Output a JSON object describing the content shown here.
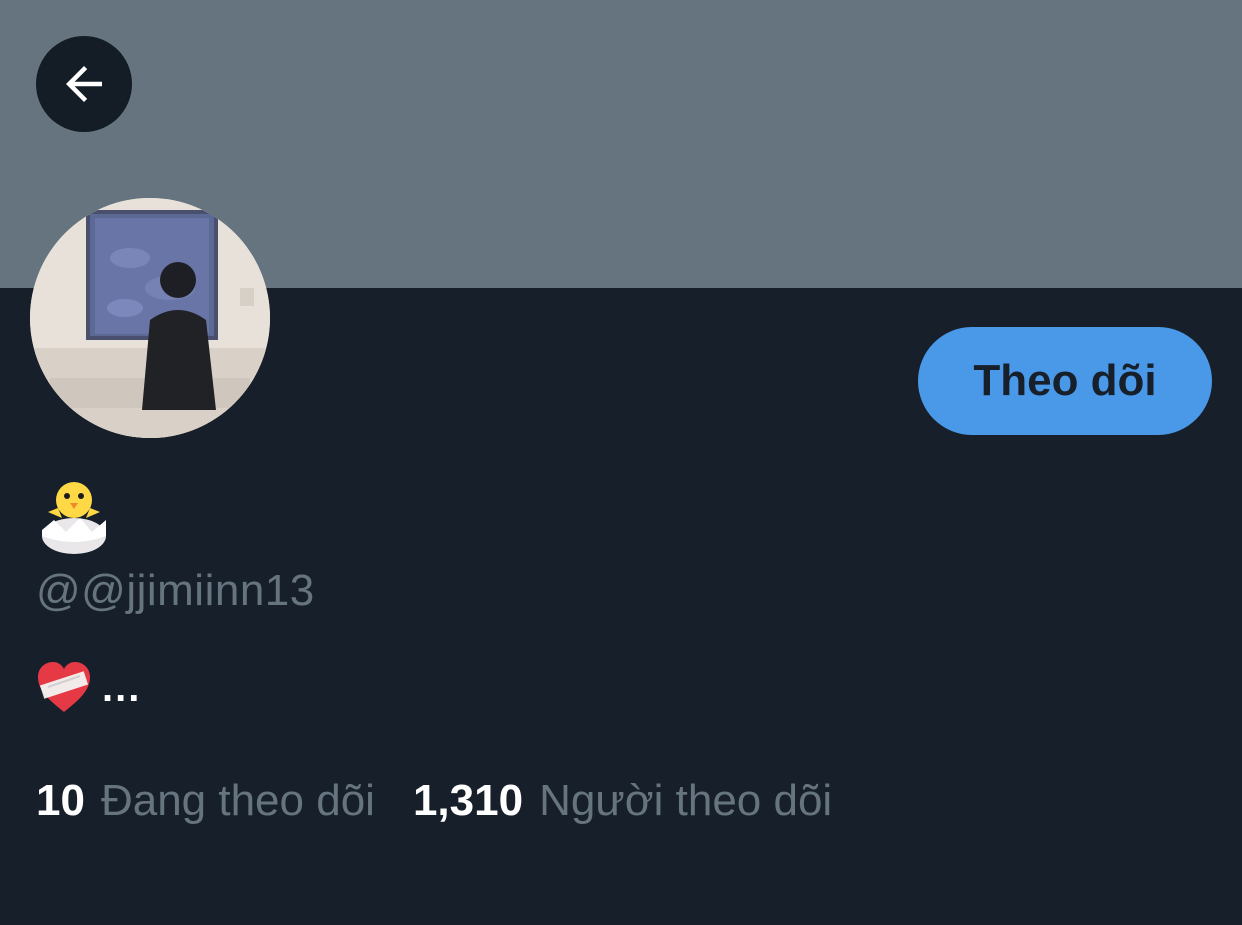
{
  "profile": {
    "display_name_icon": "hatching-chick-icon",
    "username": "@@jjimiinn13",
    "bio_icon": "mending-heart-icon",
    "bio_text": "...",
    "follow_label": "Theo dõi",
    "back_icon": "arrow-left-icon",
    "avatar_description_icon": "avatar-image"
  },
  "stats": {
    "following_count": "10",
    "following_label": "Đang theo dõi",
    "followers_count": "1,310",
    "followers_label": "Người theo dõi"
  },
  "colors": {
    "banner": "#66747f",
    "background": "#17202a",
    "accent": "#4a99e9",
    "muted_text": "#66747f",
    "primary_text": "#ffffff"
  }
}
